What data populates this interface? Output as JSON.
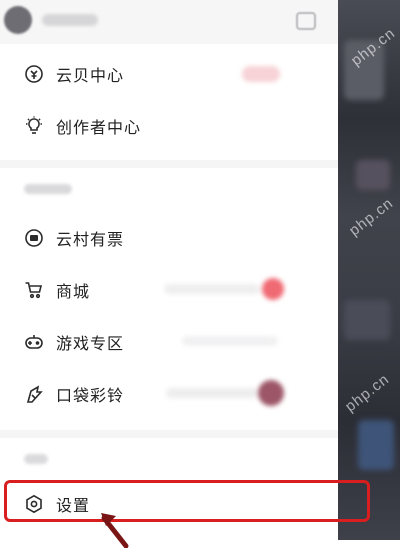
{
  "drawer": {
    "menu": [
      {
        "label": "云贝中心",
        "icon": "coin-icon"
      },
      {
        "label": "创作者中心",
        "icon": "lightbulb-icon"
      }
    ],
    "music_services": {
      "items": [
        {
          "label": "云村有票",
          "icon": "ticket-icon"
        },
        {
          "label": "商城",
          "icon": "cart-icon"
        },
        {
          "label": "游戏专区",
          "icon": "gamepad-icon"
        },
        {
          "label": "口袋彩铃",
          "icon": "ringtone-icon"
        }
      ]
    },
    "other": {
      "items": [
        {
          "label": "设置",
          "icon": "settings-hexagon-icon"
        }
      ]
    }
  },
  "watermark": "php.cn",
  "colors": {
    "highlight": "#d81e1e",
    "background_dim": "#34363e",
    "badge_red": "#f06a74",
    "ringtone_badge": "#9c5667"
  }
}
